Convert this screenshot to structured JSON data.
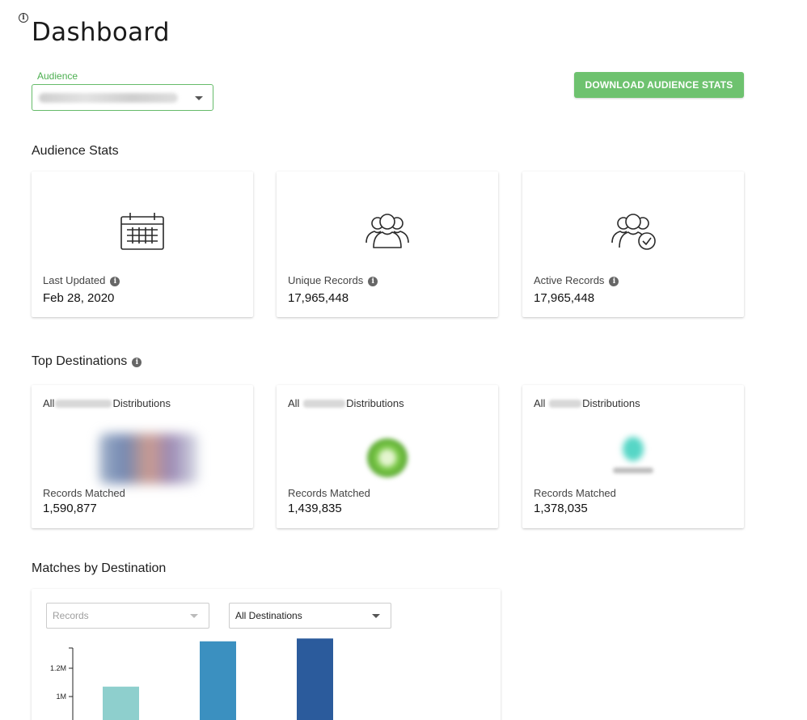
{
  "page": {
    "title": "Dashboard"
  },
  "audience": {
    "label": "Audience"
  },
  "actions": {
    "download_label": "DOWNLOAD AUDIENCE STATS"
  },
  "stats": {
    "section_title": "Audience Stats",
    "cards": [
      {
        "label": "Last Updated",
        "value": "Feb 28, 2020",
        "icon": "calendar-icon"
      },
      {
        "label": "Unique Records",
        "value": "17,965,448",
        "icon": "users-group-icon"
      },
      {
        "label": "Active Records",
        "value": "17,965,448",
        "icon": "users-check-icon"
      }
    ]
  },
  "destinations": {
    "section_title": "Top Destinations",
    "cards": [
      {
        "title_prefix": "All",
        "title_suffix": "Distributions",
        "metric_label": "Records Matched",
        "metric_value": "1,590,877"
      },
      {
        "title_prefix": "All",
        "title_suffix": "Distributions",
        "metric_label": "Records Matched",
        "metric_value": "1,439,835"
      },
      {
        "title_prefix": "All",
        "title_suffix": "Distributions",
        "metric_label": "Records Matched",
        "metric_value": "1,378,035"
      }
    ]
  },
  "matches": {
    "section_title": "Matches by Destination",
    "metric_select": {
      "placeholder": "Records"
    },
    "destination_select": {
      "value": "All Destinations"
    }
  },
  "colors": {
    "accent_green": "#6ec26f",
    "focus_green": "#4caf50"
  },
  "chart_data": {
    "type": "bar",
    "series": [
      {
        "values": [
          1070000,
          1390000,
          1410000
        ]
      }
    ],
    "bar_colors": [
      "#8ecfcd",
      "#3b90c0",
      "#2b5b9c"
    ],
    "y_ticks": [
      "1M",
      "1.2M"
    ],
    "tick_values": [
      1000000,
      1200000
    ],
    "grid": false
  }
}
